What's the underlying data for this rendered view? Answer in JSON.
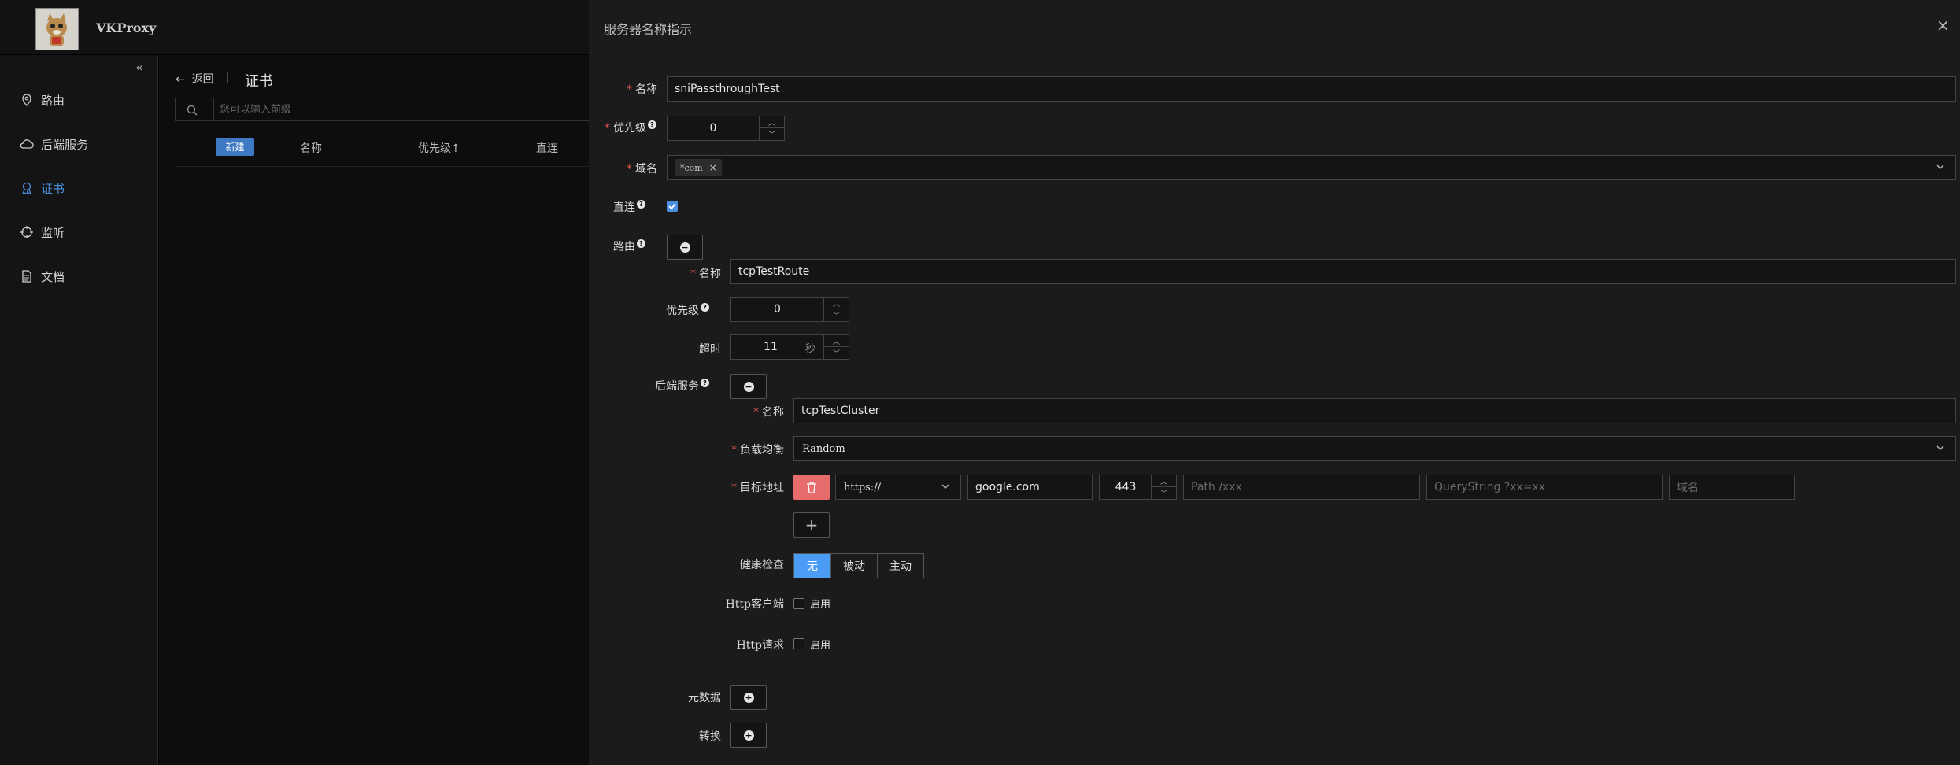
{
  "app": {
    "brand": "VKProxy"
  },
  "sidebar": {
    "collapse_icon": "double-chevron-left-icon",
    "items": [
      {
        "label": "路由",
        "icon": "location-pin-icon"
      },
      {
        "label": "后端服务",
        "icon": "cloud-icon"
      },
      {
        "label": "证书",
        "icon": "certificate-icon",
        "active": true
      },
      {
        "label": "监听",
        "icon": "crosshair-icon"
      },
      {
        "label": "文档",
        "icon": "document-icon"
      }
    ]
  },
  "main": {
    "back_label": "返回",
    "title": "证书",
    "search_placeholder": "您可以输入前缀",
    "new_label": "新建",
    "columns": [
      "名称",
      "优先级↑",
      "直连"
    ]
  },
  "drawer": {
    "title": "服务器名称指示",
    "close_icon": "close-icon",
    "name_label": "名称",
    "name_value": "sniPassthroughTest",
    "priority_label": "优先级",
    "priority_value": "0",
    "domain_label": "域名",
    "domain_tag": "*com",
    "direct_label": "直连",
    "direct_checked": true,
    "route_label": "路由",
    "route": {
      "name_label": "名称",
      "name_value": "tcpTestRoute",
      "priority_label": "优先级",
      "priority_value": "0",
      "timeout_label": "超时",
      "timeout_value": "11",
      "timeout_unit": "秒",
      "cluster_label": "后端服务",
      "cluster": {
        "name_label": "名称",
        "name_value": "tcpTestCluster",
        "lb_label": "负载均衡",
        "lb_value": "Random",
        "dest_label": "目标地址",
        "dest_scheme": "https://",
        "dest_host": "google.com",
        "dest_port": "443",
        "dest_path_placeholder": "Path /xxx",
        "dest_query_placeholder": "QueryString ?xx=xx",
        "dest_domain_placeholder": "域名",
        "health_label": "健康检查",
        "health_options": [
          "无",
          "被动",
          "主动"
        ],
        "health_selected": "无",
        "http_client_label": "Http客户端",
        "http_client_enable": "启用",
        "http_request_label": "Http请求",
        "http_request_enable": "启用"
      },
      "metadata_label": "元数据",
      "transform_label": "转换"
    }
  },
  "colors": {
    "accent": "#4a8fe0",
    "danger": "#e66b6b",
    "required": "#e0564f"
  }
}
